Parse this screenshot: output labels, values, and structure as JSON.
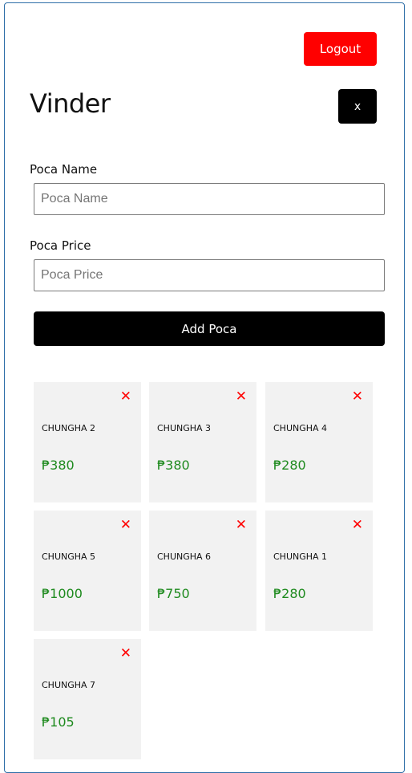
{
  "header": {
    "logout_label": "Logout",
    "title": "Vinder",
    "close_label": "x"
  },
  "form": {
    "name_label": "Poca Name",
    "name_placeholder": "Poca Name",
    "name_value": "",
    "price_label": "Poca Price",
    "price_placeholder": "Poca Price",
    "price_value": "",
    "submit_label": "Add Poca"
  },
  "cards": [
    {
      "name": "CHUNGHA 2",
      "price": "₱380",
      "delete_icon": "✕"
    },
    {
      "name": "CHUNGHA 3",
      "price": "₱380",
      "delete_icon": "✕"
    },
    {
      "name": "CHUNGHA 4",
      "price": "₱280",
      "delete_icon": "✕"
    },
    {
      "name": "CHUNGHA 5",
      "price": "₱1000",
      "delete_icon": "✕"
    },
    {
      "name": "CHUNGHA 6",
      "price": "₱750",
      "delete_icon": "✕"
    },
    {
      "name": "CHUNGHA 1",
      "price": "₱280",
      "delete_icon": "✕"
    },
    {
      "name": "CHUNGHA 7",
      "price": "₱105",
      "delete_icon": "✕"
    }
  ],
  "colors": {
    "logout": "#ff0000",
    "primary": "#000000",
    "price": "#1e8a1e",
    "delete": "#ff0000",
    "card_bg": "#f2f2f2"
  }
}
